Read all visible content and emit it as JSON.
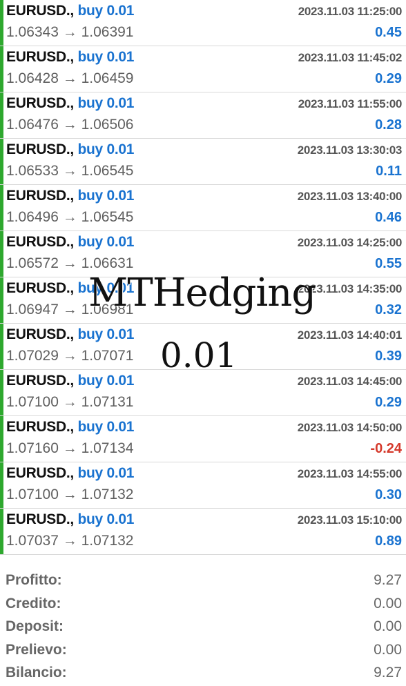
{
  "trades": [
    {
      "symbol": "EURUSD.,",
      "side": "buy 0.01",
      "time": "2023.11.03 11:25:00",
      "prices": "1.06343 → 1.06391",
      "profit": "0.45"
    },
    {
      "symbol": "EURUSD.,",
      "side": "buy 0.01",
      "time": "2023.11.03 11:45:02",
      "prices": "1.06428 → 1.06459",
      "profit": "0.29"
    },
    {
      "symbol": "EURUSD.,",
      "side": "buy 0.01",
      "time": "2023.11.03 11:55:00",
      "prices": "1.06476 → 1.06506",
      "profit": "0.28"
    },
    {
      "symbol": "EURUSD.,",
      "side": "buy 0.01",
      "time": "2023.11.03 13:30:03",
      "prices": "1.06533 → 1.06545",
      "profit": "0.11"
    },
    {
      "symbol": "EURUSD.,",
      "side": "buy 0.01",
      "time": "2023.11.03 13:40:00",
      "prices": "1.06496 → 1.06545",
      "profit": "0.46"
    },
    {
      "symbol": "EURUSD.,",
      "side": "buy 0.01",
      "time": "2023.11.03 14:25:00",
      "prices": "1.06572 → 1.06631",
      "profit": "0.55"
    },
    {
      "symbol": "EURUSD.,",
      "side": "buy 0.01",
      "time": "2023.11.03 14:35:00",
      "prices": "1.06947 → 1.06981",
      "profit": "0.32"
    },
    {
      "symbol": "EURUSD.,",
      "side": "buy 0.01",
      "time": "2023.11.03 14:40:01",
      "prices": "1.07029 → 1.07071",
      "profit": "0.39"
    },
    {
      "symbol": "EURUSD.,",
      "side": "buy 0.01",
      "time": "2023.11.03 14:45:00",
      "prices": "1.07100 → 1.07131",
      "profit": "0.29"
    },
    {
      "symbol": "EURUSD.,",
      "side": "buy 0.01",
      "time": "2023.11.03 14:50:00",
      "prices": "1.07160 → 1.07134",
      "profit": "-0.24"
    },
    {
      "symbol": "EURUSD.,",
      "side": "buy 0.01",
      "time": "2023.11.03 14:55:00",
      "prices": "1.07100 → 1.07132",
      "profit": "0.30"
    },
    {
      "symbol": "EURUSD.,",
      "side": "buy 0.01",
      "time": "2023.11.03 15:10:00",
      "prices": "1.07037 → 1.07132",
      "profit": "0.89"
    }
  ],
  "summary": [
    {
      "label": "Profitto:",
      "value": "9.27"
    },
    {
      "label": "Credito:",
      "value": "0.00"
    },
    {
      "label": "Deposit:",
      "value": "0.00"
    },
    {
      "label": "Prelievo:",
      "value": "0.00"
    },
    {
      "label": "Bilancio:",
      "value": "9.27"
    }
  ],
  "watermark": {
    "title": "MTHedging",
    "subtitle": "0.01"
  },
  "colors": {
    "buy": "#1a73d0",
    "profit_positive": "#1a73d0",
    "profit_negative": "#d53a2c",
    "position_bar": "#2ea82e"
  }
}
